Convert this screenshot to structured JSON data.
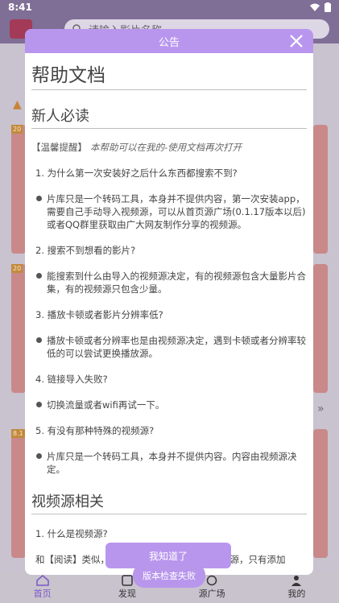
{
  "status_bar": {
    "time": "8:41"
  },
  "background": {
    "search_placeholder": "请输入影片名称",
    "tabs": [
      {
        "label": "首页",
        "active": true
      },
      {
        "label": "发现",
        "active": false
      },
      {
        "label": "源广场",
        "active": false
      },
      {
        "label": "我的",
        "active": false
      }
    ],
    "card_tags": [
      "20",
      "20",
      "8.1"
    ]
  },
  "dialog": {
    "header_title": "公告",
    "doc_title": "帮助文档",
    "section1_title": "新人必读",
    "tip_label": "【温馨提醒】",
    "tip_text": "本帮助可以在我的-使用文档再次打开",
    "faq": [
      {
        "q": "1. 为什么第一次安装好之后什么东西都搜索不到?",
        "a": "片库只是一个转码工具，本身并不提供内容，第一次安装app，需要自己手动导入视频源，可以从首页源广场(0.1.17版本以后)或者QQ群里获取由广大网友制作分享的视频源。"
      },
      {
        "q": "2. 搜索不到想看的影片?",
        "a": "能搜索到什么由导入的视频源决定，有的视频源包含大量影片合集，有的视频源只包含少量。"
      },
      {
        "q": "3. 播放卡顿或者影片分辨率低?",
        "a": "播放卡顿或者分辨率也是由视频源决定，遇到卡顿或者分辨率较低的可以尝试更换播放源。"
      },
      {
        "q": "4. 链接导入失败?",
        "a": "切换流量或者wifi再试一下。"
      },
      {
        "q": "5. 有没有那种特殊的视频源?",
        "a": "片库只是一个转码工具，本身并不提供内容。内容由视频源决定。"
      }
    ],
    "section2_title": "视频源相关",
    "section2_q1": "1. 什么是视频源?",
    "section2_partial": "和【阅读】类似，视频源就相当于【阅读】的书源，只有添加",
    "ok_label": "我知道了"
  },
  "toast": "版本检查失败",
  "colors": {
    "accent": "#b996ee",
    "active_tab": "#7b58c6"
  }
}
